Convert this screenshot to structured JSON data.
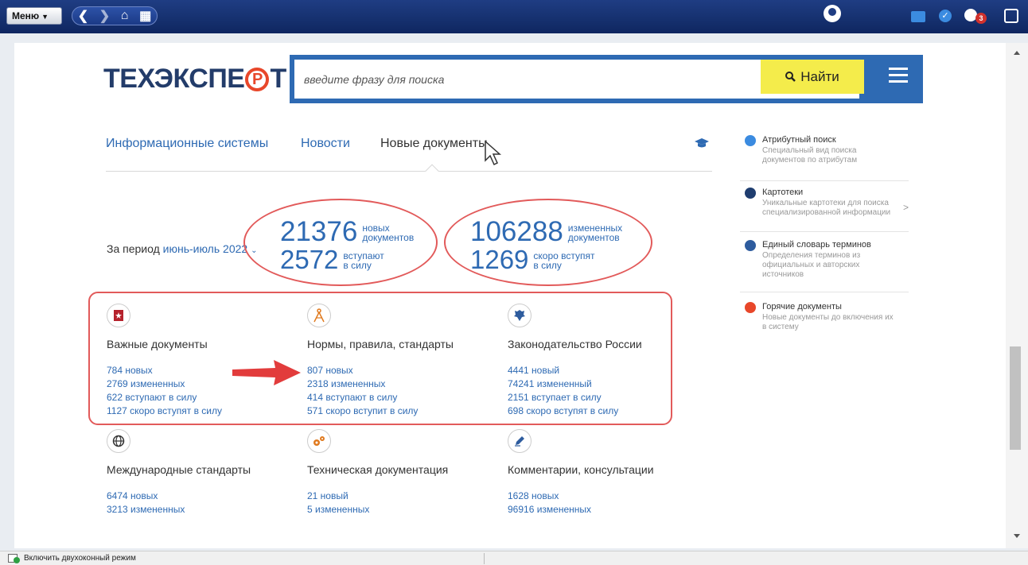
{
  "toolbar": {
    "menu_label": "Меню",
    "notification_count": "3"
  },
  "logo": {
    "text_before": "ТЕХЭКСПЕ",
    "text_r": "Р",
    "text_after": "Т"
  },
  "search": {
    "placeholder": "введите фразу для поиска",
    "button_label": "Найти"
  },
  "nav": {
    "tabs": [
      {
        "label": "Информационные системы"
      },
      {
        "label": "Новости"
      },
      {
        "label": "Новые документы"
      }
    ]
  },
  "period": {
    "label": "За период",
    "value": "июнь-июль 2022"
  },
  "stats": {
    "new_docs": {
      "num": "21376",
      "l1": "новых",
      "l2": "документов"
    },
    "in_force": {
      "num": "2572",
      "l1": "вступают",
      "l2": "в силу"
    },
    "changed_docs": {
      "num": "106288",
      "l1": "измененных",
      "l2": "документов"
    },
    "soon_force": {
      "num": "1269",
      "l1": "скоро вступят",
      "l2": "в силу"
    }
  },
  "categories": [
    {
      "title": "Важные документы",
      "lines": [
        "784 новых",
        "2769 измененных",
        "622 вступают в силу",
        "1127 скоро вступят в силу"
      ],
      "icon": "bookmark-icon"
    },
    {
      "title": "Нормы, правила, стандарты",
      "lines": [
        "807 новых",
        "2318 измененных",
        "414 вступают в силу",
        "571 скоро вступит в силу"
      ],
      "icon": "compass-icon"
    },
    {
      "title": "Законодательство России",
      "lines": [
        "4441 новый",
        "74241 измененный",
        "2151 вступает в силу",
        "698 скоро вступят в силу"
      ],
      "icon": "emblem-icon"
    },
    {
      "title": "Международные стандарты",
      "lines": [
        "6474 новых",
        "3213 измененных"
      ],
      "icon": "globe-icon"
    },
    {
      "title": "Техническая документация",
      "lines": [
        "21 новый",
        "5 измененных"
      ],
      "icon": "gears-icon"
    },
    {
      "title": "Комментарии, консультации",
      "lines": [
        "1628 новых",
        "96916 измененных"
      ],
      "icon": "pen-icon"
    }
  ],
  "sidebar": [
    {
      "title": "Атрибутный поиск",
      "desc1": "Специальный вид поиска",
      "desc2": "документов по атрибутам",
      "desc3": "",
      "color": "#3b8be0"
    },
    {
      "title": "Картотеки",
      "desc1": "Уникальные картотеки для поиска",
      "desc2": "специализированной информации",
      "desc3": "",
      "color": "#1f3d6f"
    },
    {
      "title": "Единый словарь терминов",
      "desc1": "Определения терминов из",
      "desc2": "официальных и авторских",
      "desc3": "источников",
      "color": "#2e5c9e"
    },
    {
      "title": "Горячие документы",
      "desc1": "Новые документы до включения их",
      "desc2": "в систему",
      "desc3": "",
      "color": "#e8472a"
    }
  ],
  "status": {
    "dual_window": "Включить двухоконный режим"
  }
}
